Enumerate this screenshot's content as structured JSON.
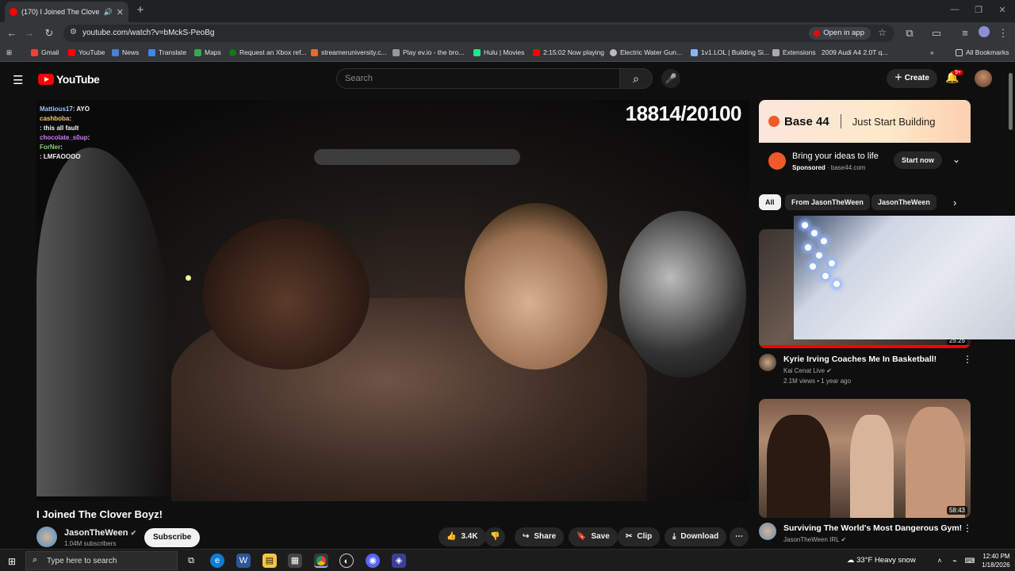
{
  "browser": {
    "tab_title": "(170) I Joined The Clover Bo",
    "url": "youtube.com/watch?v=bMckS-PeoBg",
    "open_in_app": "Open in app",
    "bookmarks": [
      "Gmail",
      "YouTube",
      "News",
      "Translate",
      "Maps",
      "Request an Xbox ref...",
      "streameruniversity.c...",
      "Play ev.io - the bro...",
      "Hulu | Movies",
      "2:15:02 Now playing",
      "Electric Water Gun...",
      "1v1.LOL | Building Si...",
      "Extensions",
      "2009 Audi A4 2.0T q..."
    ],
    "all_bookmarks": "All Bookmarks"
  },
  "masthead": {
    "logo": "YouTube",
    "search_placeholder": "Search",
    "create": "Create",
    "notif_badge": "9+"
  },
  "video": {
    "counter": "18814/20100",
    "chat": [
      {
        "name": "Mattious17",
        "msg": ": AYO"
      },
      {
        "name": "cashboba",
        "msg": ":"
      },
      {
        "name": "",
        "msg": ": this all    fault"
      },
      {
        "name": "chocolate_s0up",
        "msg": ":"
      },
      {
        "name": "ForNer",
        "msg": ":"
      },
      {
        "name": "",
        "msg": ": LMFAOOOO"
      },
      {
        "name": "",
        "msg": ""
      }
    ],
    "title": "I Joined The Clover Boyz!",
    "channel": "JasonTheWeen",
    "subscribers": "1.04M subscribers",
    "subscribe": "Subscribe",
    "likes": "3.4K",
    "share": "Share",
    "save": "Save",
    "clip": "Clip",
    "download": "Download"
  },
  "ad": {
    "brand": "Base 44",
    "tagline": "Just Start Building",
    "title": "Bring your ideas to life",
    "sponsored": "Sponsored",
    "domain": "base44.com",
    "cta": "Start now"
  },
  "chips": [
    "All",
    "From JasonTheWeen",
    "JasonTheWeen"
  ],
  "recommendations": [
    {
      "title": "Kyrie Irving Coaches Me In Basketball!",
      "channel": "Kai Cenat Live",
      "meta": "2.1M views • 1 year ago",
      "duration": "25:25"
    },
    {
      "title": "Surviving The World's Most Dangerous Gym!",
      "channel": "JasonTheWeen IRL",
      "meta": "",
      "duration": "58:43"
    }
  ],
  "taskbar": {
    "search": "Type here to search",
    "weather": "33°F  Heavy snow",
    "time": "12:40 PM",
    "date": "1/18/2026"
  }
}
